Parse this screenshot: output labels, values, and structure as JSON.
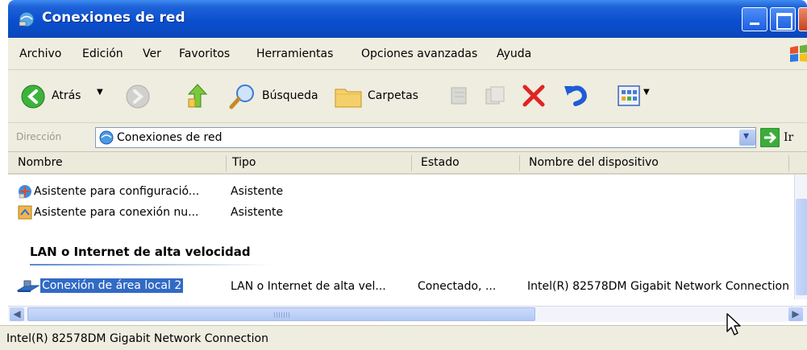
{
  "window": {
    "title": "Conexiones de red"
  },
  "menu": [
    "Archivo",
    "Edición",
    "Ver",
    "Favoritos",
    "Herramientas",
    "Opciones avanzadas",
    "Ayuda"
  ],
  "toolbar": {
    "back_label": "Atrás",
    "search_label": "Búsqueda",
    "folders_label": "Carpetas"
  },
  "address": {
    "label": "Dirección",
    "value": "Conexiones de red",
    "go_label": "Ir"
  },
  "columns": [
    "Nombre",
    "Tipo",
    "Estado",
    "Nombre del dispositivo"
  ],
  "wizards": [
    {
      "name": "Asistente para configuració...",
      "type": "Asistente",
      "icon": "network-setup-wizard-icon"
    },
    {
      "name": "Asistente para conexión nu...",
      "type": "Asistente",
      "icon": "new-connection-wizard-icon"
    }
  ],
  "group": {
    "title": "LAN o Internet de alta velocidad"
  },
  "connection": {
    "name": "Conexión de área local 2",
    "type": "LAN o Internet de alta vel...",
    "status": "Conectado, ...",
    "device": "Intel(R) 82578DM Gigabit Network Connection"
  },
  "status_bar": {
    "text": "Intel(R) 82578DM Gigabit Network Connection"
  },
  "colors": {
    "selection": "#316ac5",
    "titlebar": "#0a4fd0"
  }
}
